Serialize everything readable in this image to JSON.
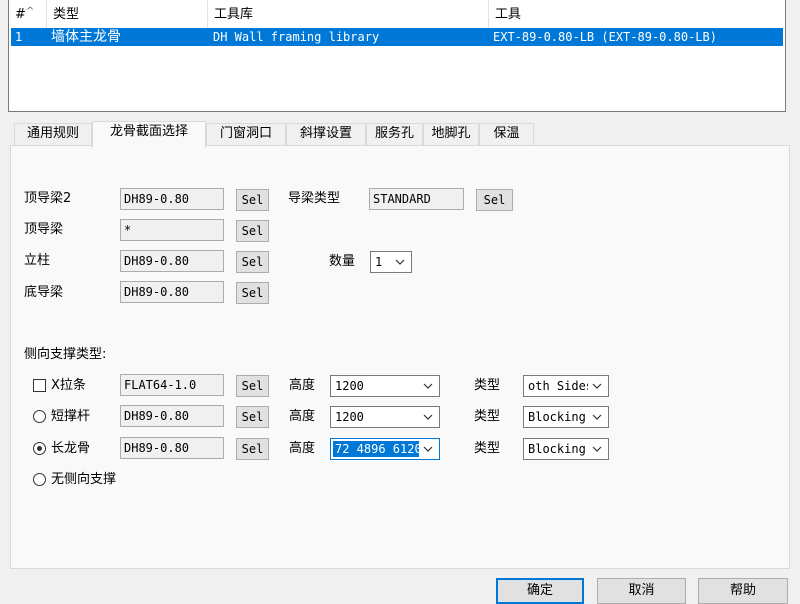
{
  "list": {
    "columns": [
      "#",
      "类型",
      "工具库",
      "工具"
    ],
    "rows": [
      {
        "index": "1",
        "type": "墙体主龙骨",
        "library": "DH Wall framing library",
        "tool": "EXT-89-0.80-LB (EXT-89-0.80-LB)"
      }
    ]
  },
  "tabs": [
    "通用规则",
    "龙骨截面选择",
    "门窗洞口",
    "斜撑设置",
    "服务孔",
    "地脚孔",
    "保温"
  ],
  "active_tab": "龙骨截面选择",
  "section": {
    "top_track2": {
      "label": "顶导梁2",
      "value": "DH89-0.80",
      "button": "Sel"
    },
    "top_track": {
      "label": "顶导梁",
      "value": "*",
      "button": "Sel"
    },
    "stud": {
      "label": "立柱",
      "value": "DH89-0.80",
      "button": "Sel"
    },
    "bottom_track": {
      "label": "底导梁",
      "value": "DH89-0.80",
      "button": "Sel"
    },
    "track_type": {
      "label": "导梁类型",
      "value": "STANDARD",
      "button": "Sel"
    },
    "quantity": {
      "label": "数量",
      "value": "1"
    }
  },
  "bracing": {
    "title": "侧向支撑类型:",
    "strap": {
      "label": "X拉条",
      "checked": false,
      "value": "FLAT64-1.0",
      "button": "Sel",
      "height_label": "高度",
      "height": "1200",
      "type_label": "类型",
      "type": "oth Sides"
    },
    "short_brace": {
      "label": "短撑杆",
      "selected": false,
      "value": "DH89-0.80",
      "button": "Sel",
      "height_label": "高度",
      "height": "1200",
      "type_label": "类型",
      "type": "Blocking"
    },
    "long_stud": {
      "label": "长龙骨",
      "selected": true,
      "value": "DH89-0.80",
      "button": "Sel",
      "height_label": "高度",
      "height": "72 4896 6120",
      "type_label": "类型",
      "type": "Blocking"
    },
    "none": {
      "label": "无侧向支撑",
      "selected": false
    }
  },
  "buttons": {
    "ok": "确定",
    "cancel": "取消",
    "help": "帮助"
  },
  "colors": {
    "selection": "#0078d7",
    "panel": "#f9f9f9",
    "dialog": "#f0f0f0"
  }
}
